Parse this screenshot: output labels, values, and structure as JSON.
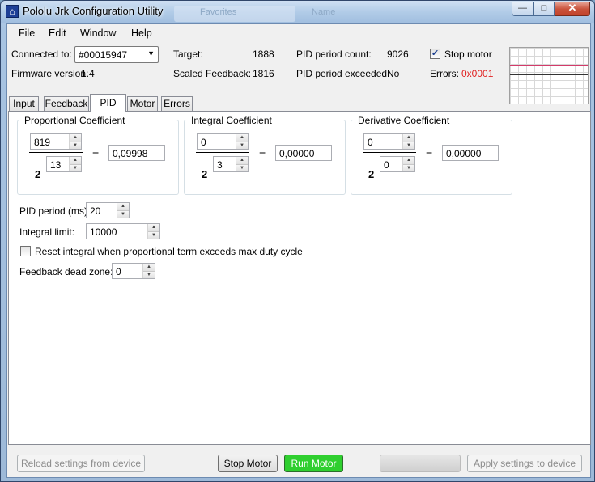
{
  "window": {
    "title": "Pololu Jrk Configuration Utility",
    "background_hints": [
      "Favorites",
      "Name"
    ]
  },
  "titlebar_buttons": {
    "minimize": "—",
    "maximize": "□",
    "close": "✕"
  },
  "menu": [
    "File",
    "Edit",
    "Window",
    "Help"
  ],
  "status": {
    "connected_label": "Connected to:",
    "device": "#00015947",
    "firmware_label": "Firmware version:",
    "firmware": "1.4",
    "target_label": "Target:",
    "target": "1888",
    "scaled_feedback_label": "Scaled Feedback:",
    "scaled_feedback": "1816",
    "pid_count_label": "PID period count:",
    "pid_count": "9026",
    "pid_exceeded_label": "PID period exceeded:",
    "pid_exceeded": "No",
    "stop_motor_label": "Stop motor",
    "stop_motor_checked": true,
    "errors_label": "Errors:",
    "errors": "0x0001",
    "errors_color": "#e02020"
  },
  "tabs": [
    "Input",
    "Feedback",
    "PID",
    "Motor",
    "Errors"
  ],
  "active_tab": "PID",
  "pid": {
    "proportional": {
      "title": "Proportional Coefficient",
      "numerator": "819",
      "exponent": "13",
      "base": "2",
      "result": "0,09998"
    },
    "integral": {
      "title": "Integral Coefficient",
      "numerator": "0",
      "exponent": "3",
      "base": "2",
      "result": "0,00000"
    },
    "derivative": {
      "title": "Derivative Coefficient",
      "numerator": "0",
      "exponent": "0",
      "base": "2",
      "result": "0,00000"
    },
    "equals": "=",
    "pid_period_label": "PID period (ms):",
    "pid_period": "20",
    "integral_limit_label": "Integral limit:",
    "integral_limit": "10000",
    "reset_integral_label": "Reset integral when proportional term exceeds max duty cycle",
    "reset_integral_checked": false,
    "dead_zone_label": "Feedback dead zone:",
    "dead_zone": "0"
  },
  "bottom_bar": {
    "reload": "Reload settings from device",
    "stop_motor": "Stop Motor",
    "run_motor": "Run Motor",
    "apply": "Apply settings to device"
  },
  "colors": {
    "run_motor_bg": "#2fcf2f",
    "graph_target_line": "#d33b6a"
  },
  "icons": {
    "app": "pololu-logo-icon",
    "dropdown": "chevron-down-icon",
    "spin": "up-down-arrows-icon"
  }
}
